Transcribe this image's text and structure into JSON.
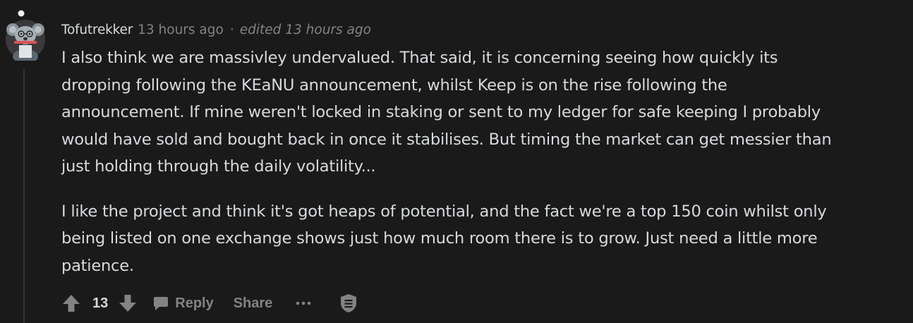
{
  "comment": {
    "author": "Tofutrekker",
    "timestamp": "13 hours ago",
    "separator": "·",
    "edited": "edited 13 hours ago",
    "paragraphs": [
      "I also think we are massivley undervalued. That said, it is concerning seeing how quickly its\ndropping following the KEaNU announcement, whilst Keep is on the rise following the\nannouncement. If mine weren't locked in staking or sent to my ledger for safe keeping I probably\nwould have sold and bought back in once it stabilises. But timing the market can get messier than\njust holding through the daily volatility...",
      "I like the project and think it's got heaps of potential, and the fact we're a top 150 coin whilst only\nbeing listed on one exchange shows just how much room there is to grow. Just need a little more\npatience."
    ]
  },
  "actions": {
    "score": "13",
    "reply_label": "Reply",
    "share_label": "Share",
    "icons": [
      "upvote-icon",
      "downvote-icon",
      "comment-bubble-icon",
      "more-options-icon",
      "shield-icon"
    ]
  },
  "colors": {
    "background": "#1a1a1b",
    "text": "#d7dadc",
    "muted": "#818384",
    "thread_line": "#343536"
  }
}
